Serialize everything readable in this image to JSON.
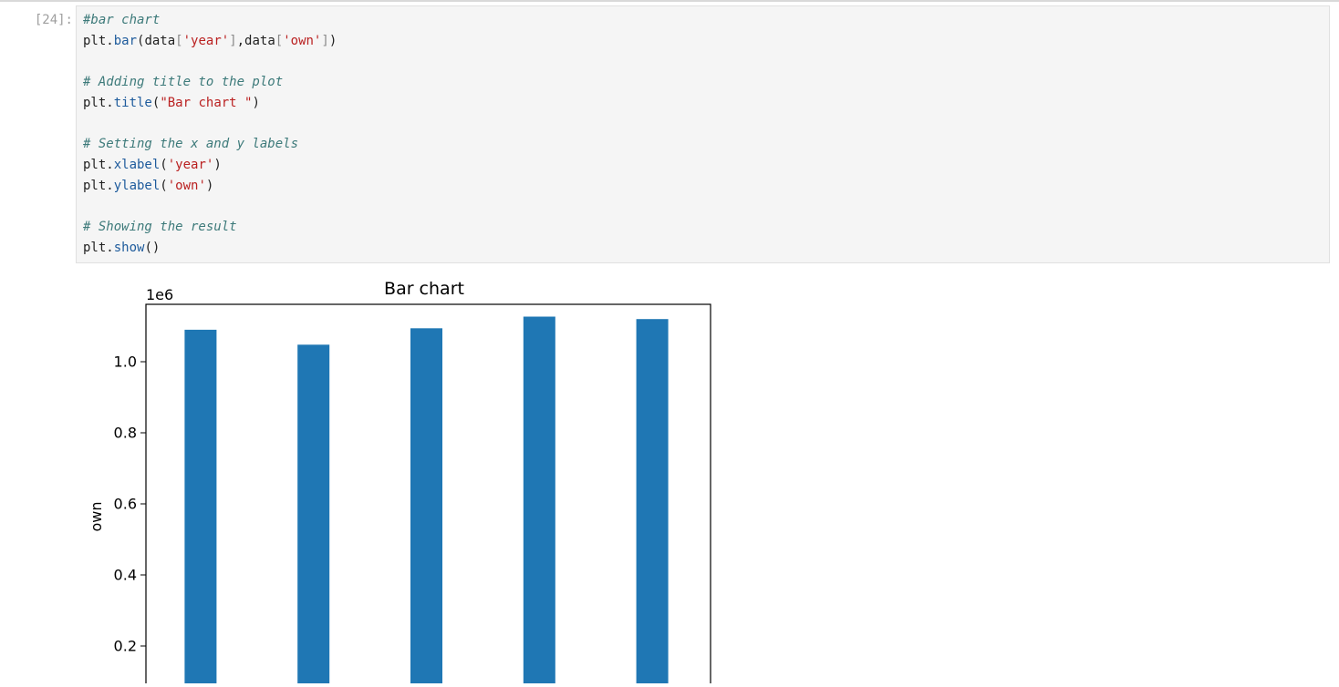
{
  "cell": {
    "prompt": "[24]:",
    "code_lines": [
      [
        {
          "t": "comment",
          "v": "#bar chart"
        }
      ],
      [
        {
          "t": "plain",
          "v": "plt."
        },
        {
          "t": "attr",
          "v": "bar"
        },
        {
          "t": "plain",
          "v": "(data"
        },
        {
          "t": "dim",
          "v": "["
        },
        {
          "t": "string",
          "v": "'year'"
        },
        {
          "t": "dim",
          "v": "]"
        },
        {
          "t": "plain",
          "v": ",data"
        },
        {
          "t": "dim",
          "v": "["
        },
        {
          "t": "string",
          "v": "'own'"
        },
        {
          "t": "dim",
          "v": "]"
        },
        {
          "t": "plain",
          "v": ")"
        }
      ],
      [],
      [
        {
          "t": "comment",
          "v": "# Adding title to the plot"
        }
      ],
      [
        {
          "t": "plain",
          "v": "plt."
        },
        {
          "t": "attr",
          "v": "title"
        },
        {
          "t": "plain",
          "v": "("
        },
        {
          "t": "string",
          "v": "\"Bar chart \""
        },
        {
          "t": "plain",
          "v": ")"
        }
      ],
      [],
      [
        {
          "t": "comment",
          "v": "# Setting the x and y labels"
        }
      ],
      [
        {
          "t": "plain",
          "v": "plt."
        },
        {
          "t": "attr",
          "v": "xlabel"
        },
        {
          "t": "plain",
          "v": "("
        },
        {
          "t": "string",
          "v": "'year'"
        },
        {
          "t": "plain",
          "v": ")"
        }
      ],
      [
        {
          "t": "plain",
          "v": "plt."
        },
        {
          "t": "attr",
          "v": "ylabel"
        },
        {
          "t": "plain",
          "v": "("
        },
        {
          "t": "string",
          "v": "'own'"
        },
        {
          "t": "plain",
          "v": ")"
        }
      ],
      [],
      [
        {
          "t": "comment",
          "v": "# Showing the result"
        }
      ],
      [
        {
          "t": "plain",
          "v": "plt."
        },
        {
          "t": "attr",
          "v": "show"
        },
        {
          "t": "plain",
          "v": "()"
        }
      ]
    ]
  },
  "colors": {
    "bar": "#1f77b4",
    "comment": "#3d7a7a",
    "string": "#ba2121",
    "attr": "#1e5b9c"
  },
  "chart_data": {
    "type": "bar",
    "title": "Bar chart",
    "ylabel": "own",
    "y_offset_label": "1e6",
    "values": [
      1090000,
      1048000,
      1094000,
      1127000,
      1120000
    ],
    "ylim": [
      0,
      1180000
    ],
    "yticks": [
      0.2,
      0.4,
      0.6,
      0.8,
      1.0
    ],
    "ytick_labels": [
      "0.2",
      "0.4",
      "0.6",
      "0.8",
      "1.0"
    ],
    "grid": false
  }
}
